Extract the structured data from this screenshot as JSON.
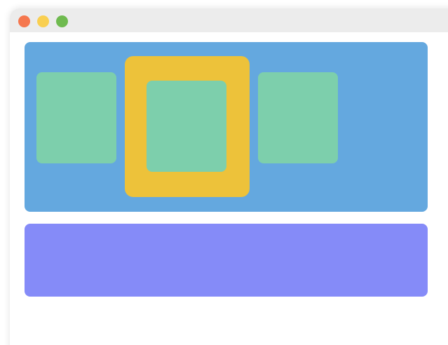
{
  "window": {
    "controls": [
      {
        "name": "close-button",
        "color": "#f5774e"
      },
      {
        "name": "minimize-button",
        "color": "#f9cf50"
      },
      {
        "name": "zoom-button",
        "color": "#6fba4f"
      }
    ]
  },
  "colors": {
    "main_panel": "#64a8df",
    "tile": "#7dcfac",
    "focus_frame": "#edc23a",
    "bottom_panel": "#858bf8"
  },
  "carousel": {
    "items": [
      "tile-left",
      "tile-center",
      "tile-right"
    ],
    "selected_index": 1
  }
}
